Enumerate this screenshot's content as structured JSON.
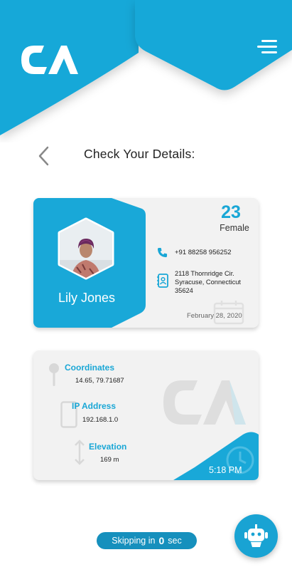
{
  "header": {
    "logo_text": "CA"
  },
  "page": {
    "title": "Check Your Details:"
  },
  "profile": {
    "name": "Lily Jones",
    "age": "23",
    "gender": "Female",
    "phone": "+91 88258 956252",
    "address_line1": "2118 Thornridge Cir.",
    "address_line2": "Syracuse, Connecticut",
    "address_line3": "35624",
    "date": "February 28, 2020"
  },
  "network": {
    "coordinates_label": "Coordinates",
    "coordinates_value": "14.65, 79.71687",
    "ip_label": "IP Address",
    "ip_value": "192.168.1.0",
    "elevation_label": "Elevation",
    "elevation_value": "169 m",
    "time": "5:18 PM"
  },
  "footer": {
    "skip_prefix": "Skipping in",
    "skip_count": "0",
    "skip_suffix": "sec"
  },
  "colors": {
    "brand_blue": "#1aa7d6",
    "dark_blue": "#1690bd",
    "card_bg": "#f2f2f2"
  },
  "icons": [
    "ca-logo",
    "menu-icon",
    "back-arrow-icon",
    "phone-icon",
    "address-book-icon",
    "calendar-icon",
    "location-pin-icon",
    "device-icon",
    "elevation-icon",
    "clock-icon",
    "robot-icon"
  ]
}
